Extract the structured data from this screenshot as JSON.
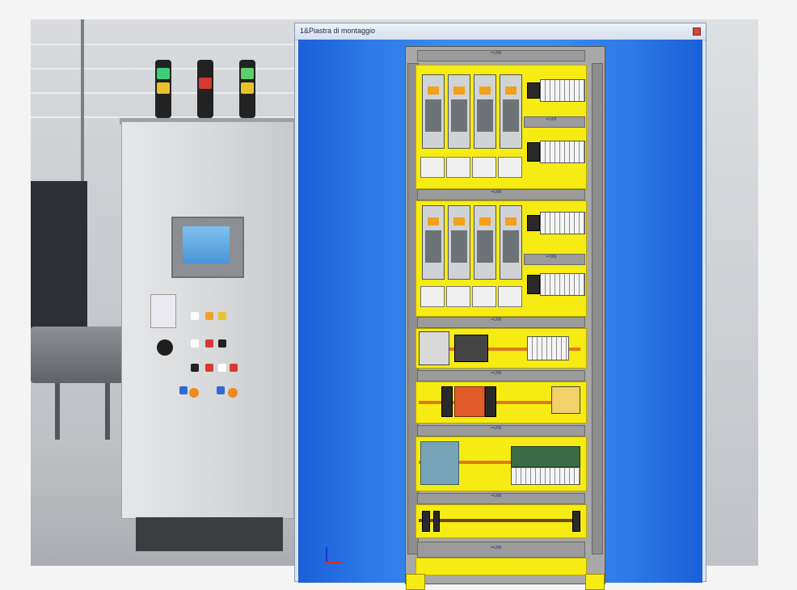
{
  "window": {
    "title": "1&Piastra di montaggio"
  },
  "plate": {
    "duct_labels": [
      "=UIN",
      "=UIN",
      "=UIN",
      "=UIN",
      "=UIN",
      "=UIN",
      "=UIN",
      "=UIN",
      "=UIN",
      "=UIN"
    ]
  },
  "colors": {
    "canvas_blue": "#3b8cf0",
    "zone_yellow": "#f6eb12",
    "wire_orange": "#e07a1a",
    "plate_gray": "#a8a8a8"
  },
  "icons": {
    "beacons": [
      "green-yellow-beacon-icon",
      "red-beacon-icon",
      "yellow-beacon-icon"
    ],
    "close": "close-icon"
  }
}
